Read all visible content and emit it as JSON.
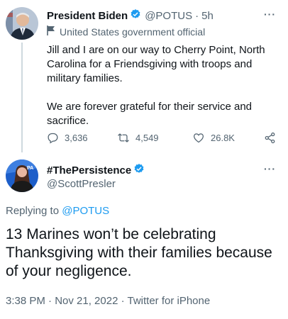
{
  "tweet1": {
    "display_name": "President Biden",
    "handle": "@POTUS",
    "time": "5h",
    "label": "United States government official",
    "text_p1": "Jill and I are on our way to Cherry Point, North Carolina for a Friendsgiving with troops and military families.",
    "text_p2": "We are forever grateful for their service and sacrifice.",
    "replies": "3,636",
    "retweets": "4,549",
    "likes": "26.8K"
  },
  "tweet2": {
    "display_name": "#ThePersistence",
    "handle": "@ScottPresler",
    "replying_prefix": "Replying to",
    "replying_handle": "@POTUS",
    "text": "13 Marines won’t be celebrating Thanksgiving with their families because of your negligence.",
    "timestamp": "3:38 PM · Nov 21, 2022 · Twitter for iPhone"
  },
  "colors": {
    "accent": "#1d9bf0",
    "secondary_text": "#536471"
  },
  "icons": [
    "verified-badge-icon",
    "flag-icon",
    "reply-icon",
    "retweet-icon",
    "like-icon",
    "share-icon",
    "more-icon"
  ]
}
